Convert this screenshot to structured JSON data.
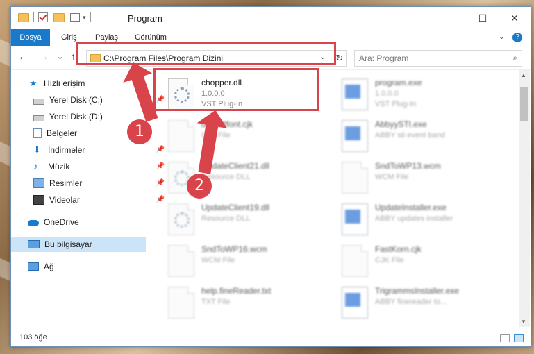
{
  "window": {
    "title": "Program",
    "controls": {
      "minimize": "—",
      "maximize": "☐",
      "close": "✕"
    }
  },
  "ribbon": {
    "tabs": [
      "Dosya",
      "Giriş",
      "Paylaş",
      "Görünüm"
    ],
    "expand_icon": "chevron-down-icon",
    "help": "?"
  },
  "nav": {
    "back": "←",
    "forward": "→",
    "recent": "⌄",
    "up": "↑",
    "address": "C:\\Program Files\\Program Dizini",
    "search_placeholder": "Ara: Program"
  },
  "sidebar": {
    "items": [
      {
        "label": "Hızlı erişim",
        "icon": "star-icon"
      },
      {
        "label": "Yerel Disk (C:)",
        "icon": "drive-icon",
        "pinned": true
      },
      {
        "label": "Yerel Disk (D:)",
        "icon": "drive-icon"
      },
      {
        "label": "Belgeler",
        "icon": "documents-icon"
      },
      {
        "label": "İndirmeler",
        "icon": "download-icon",
        "pinned": true
      },
      {
        "label": "Müzik",
        "icon": "music-icon",
        "pinned": true
      },
      {
        "label": "Resimler",
        "icon": "pictures-icon",
        "pinned": true
      },
      {
        "label": "Videolar",
        "icon": "videos-icon",
        "pinned": true
      },
      {
        "label": "OneDrive",
        "icon": "cloud-icon"
      },
      {
        "label": "Bu bilgisayar",
        "icon": "computer-icon",
        "selected": true
      },
      {
        "label": "Ağ",
        "icon": "network-icon"
      }
    ]
  },
  "files": [
    {
      "name": "chopper.dll",
      "line2": "1.0.0.0",
      "line3": "VST Plug-In",
      "kind": "dll",
      "highlight": true
    },
    {
      "name": "program.exe",
      "line2": "1.0.0.0",
      "line3": "VST Plug-In",
      "kind": "exe"
    },
    {
      "name": "defaultfont.cjk",
      "line2": "CJK File",
      "line3": "",
      "kind": "doc"
    },
    {
      "name": "AbbyySTI.exe",
      "line2": "ABBY sti event band",
      "line3": "",
      "kind": "exe"
    },
    {
      "name": "UpdateClient21.dll",
      "line2": "Resource DLL",
      "line3": "",
      "kind": "dll"
    },
    {
      "name": "SndToWP13.wcm",
      "line2": "WCM File",
      "line3": "",
      "kind": "doc"
    },
    {
      "name": "UpdateClient19.dll",
      "line2": "Resource DLL",
      "line3": "",
      "kind": "dll"
    },
    {
      "name": "UpdateInstaller.exe",
      "line2": "ABBY updates installer",
      "line3": "",
      "kind": "exe"
    },
    {
      "name": "SndToWP16.wcm",
      "line2": "WCM File",
      "line3": "",
      "kind": "doc"
    },
    {
      "name": "FastKorn.cjk",
      "line2": "CJK File",
      "line3": "",
      "kind": "doc"
    },
    {
      "name": "help.fineReader.txt",
      "line2": "TXT File",
      "line3": "",
      "kind": "doc"
    },
    {
      "name": "TrigrammsInstaller.exe",
      "line2": "ABBY finereader to...",
      "line3": "",
      "kind": "exe"
    }
  ],
  "status": {
    "count": "103 öğe"
  },
  "annotations": {
    "step1": "1",
    "step2": "2",
    "color": "#d8444a"
  }
}
